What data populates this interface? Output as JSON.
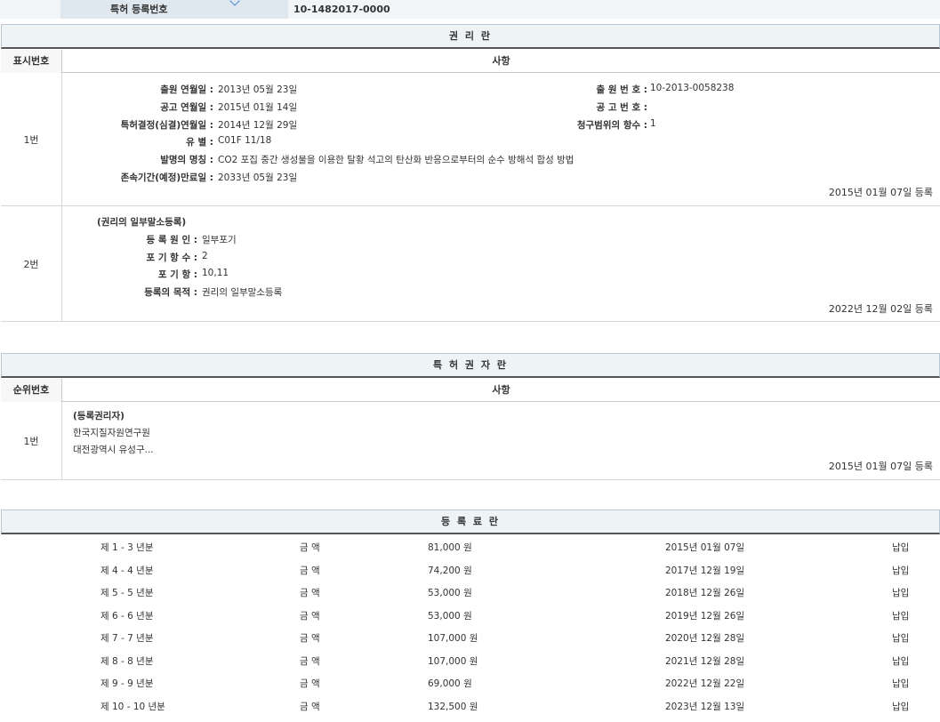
{
  "top": {
    "label": "특허 등록번호",
    "value": "10-1482017-0000"
  },
  "rights": {
    "title": "권 리 란",
    "col_num": "표시번호",
    "col_desc": "사항",
    "entries": [
      {
        "num": "1번",
        "left": [
          {
            "k": "출원 연월일 :",
            "v": "2013년 05월 23일"
          },
          {
            "k": "공고 연월일 :",
            "v": "2015년 01월 14일"
          },
          {
            "k": "특허결정(심결)연월일 :",
            "v": "2014년 12월 29일"
          },
          {
            "k": "유 별 :",
            "v": "C01F 11/18"
          },
          {
            "k": "발명의 명칭 :",
            "v": "CO2 포집 중간 생성물을 이용한 탈황 석고의 탄산화 반응으로부터의 순수 방해석 합성 방법"
          },
          {
            "k": "존속기간(예정)만료일 :",
            "v": "2033년 05월 23일"
          }
        ],
        "right": [
          {
            "k": "출 원 번 호 :",
            "v": "10-2013-0058238"
          },
          {
            "k": "공 고 번 호 :",
            "v": ""
          },
          {
            "k": "청구범위의 항수 :",
            "v": "1"
          }
        ],
        "date": "2015년 01월 07일 등록"
      },
      {
        "num": "2번",
        "heading": "(권리의 일부말소등록)",
        "left": [
          {
            "k": "등 록 원 인 :",
            "v": "일부포기"
          },
          {
            "k": "포 기 항 수 :",
            "v": "2"
          },
          {
            "k": "포 기 항 :",
            "v": "10,11"
          },
          {
            "k": "등록의 목적 :",
            "v": "권리의 일부말소등록"
          }
        ],
        "date": "2022년 12월 02일 등록"
      }
    ]
  },
  "holders": {
    "title": "특 허 권 자 란",
    "col_num": "순위번호",
    "col_desc": "사항",
    "entry": {
      "num": "1번",
      "heading": "(등록권리자)",
      "name": "한국지질자원연구원",
      "address": "대전광역시 유성구...",
      "date": "2015년 01월 07일 등록"
    }
  },
  "fees": {
    "title": "등 록 료 란",
    "amount_label": "금 액",
    "rows": [
      {
        "period": "제 1 - 3 년분",
        "amount": "81,000 원",
        "date": "2015년 01월 07일",
        "status": "납입"
      },
      {
        "period": "제 4 - 4 년분",
        "amount": "74,200 원",
        "date": "2017년 12월 19일",
        "status": "납입"
      },
      {
        "period": "제 5 - 5 년분",
        "amount": "53,000 원",
        "date": "2018년 12월 26일",
        "status": "납입"
      },
      {
        "period": "제 6 - 6 년분",
        "amount": "53,000 원",
        "date": "2019년 12월 26일",
        "status": "납입"
      },
      {
        "period": "제 7 - 7 년분",
        "amount": "107,000 원",
        "date": "2020년 12월 28일",
        "status": "납입"
      },
      {
        "period": "제 8 - 8 년분",
        "amount": "107,000 원",
        "date": "2021년 12월 28일",
        "status": "납입"
      },
      {
        "period": "제 9 - 9 년분",
        "amount": "69,000 원",
        "date": "2022년 12월 22일",
        "status": "납입"
      },
      {
        "period": "제 10 - 10 년분",
        "amount": "132,500 원",
        "date": "2023년 12월 13일",
        "status": "납입"
      }
    ]
  }
}
